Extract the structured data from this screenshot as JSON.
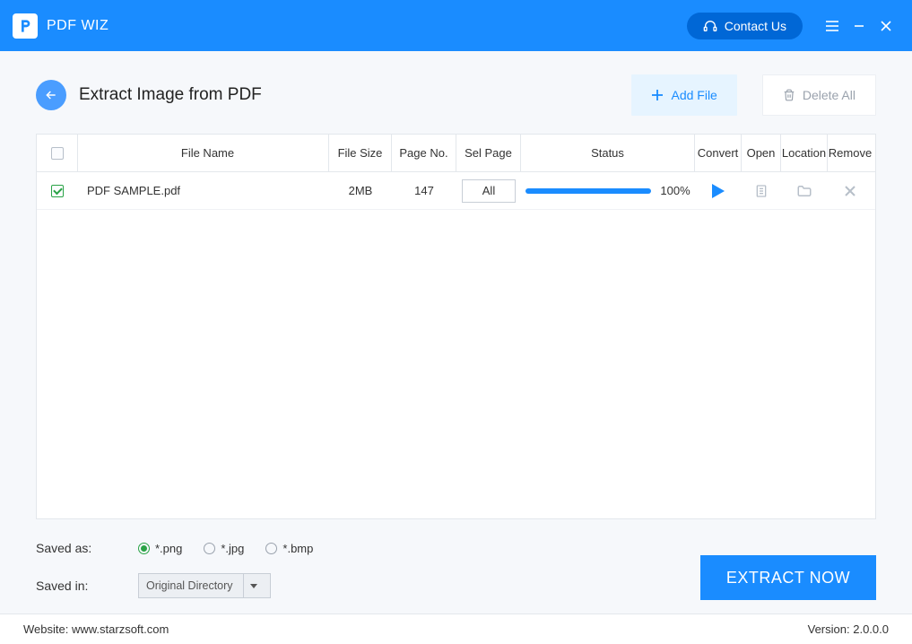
{
  "app": {
    "title": "PDF WIZ"
  },
  "titlebar": {
    "contact": "Contact Us"
  },
  "page": {
    "title": "Extract Image from PDF",
    "add_file": "Add File",
    "delete_all": "Delete All"
  },
  "columns": {
    "name": "File Name",
    "size": "File Size",
    "page": "Page No.",
    "sel": "Sel Page",
    "status": "Status",
    "convert": "Convert",
    "open": "Open",
    "location": "Location",
    "remove": "Remove"
  },
  "rows": [
    {
      "checked": true,
      "name": "PDF SAMPLE.pdf",
      "size": "2MB",
      "page": "147",
      "sel": "All",
      "pct": "100%"
    }
  ],
  "options": {
    "saved_as_label": "Saved as:",
    "formats": [
      "*.png",
      "*.jpg",
      "*.bmp"
    ],
    "selected_format": 0,
    "saved_in_label": "Saved in:",
    "saved_in_value": "Original Directory",
    "extract": "EXTRACT NOW"
  },
  "footer": {
    "website_label": "Website:",
    "website": "www.starzsoft.com",
    "version_label": "Version:",
    "version": "2.0.0.0"
  }
}
